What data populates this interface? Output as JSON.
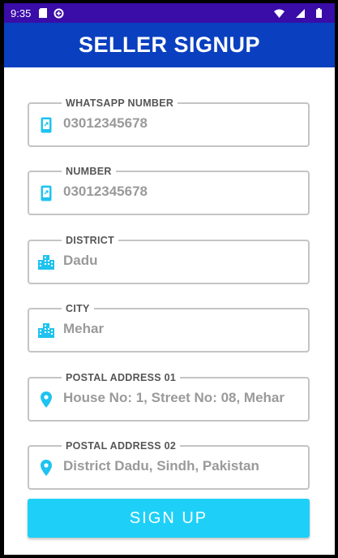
{
  "status_bar": {
    "time": "9:35",
    "icons_left": [
      "sd-card-icon",
      "data-saver-icon"
    ],
    "icons_right": [
      "wifi-icon",
      "signal-icon",
      "battery-icon"
    ]
  },
  "app_bar": {
    "title": "SELLER SIGNUP"
  },
  "form": {
    "fields": [
      {
        "label": "WHATSAPP NUMBER",
        "value": "03012345678",
        "icon": "phone-icon"
      },
      {
        "label": "NUMBER",
        "value": "03012345678",
        "icon": "phone-icon"
      },
      {
        "label": "DISTRICT",
        "value": "Dadu",
        "icon": "building-icon"
      },
      {
        "label": "CITY",
        "value": "Mehar",
        "icon": "building-icon"
      },
      {
        "label": "POSTAL ADDRESS 01",
        "value": "House No: 1, Street No: 08, Mehar",
        "icon": "location-pin-icon"
      },
      {
        "label": "POSTAL ADDRESS 02",
        "value": "District Dadu, Sindh, Pakistan",
        "icon": "location-pin-icon"
      }
    ],
    "submit_label": "SIGN UP"
  },
  "colors": {
    "status_bar": "#3a0ca8",
    "app_bar": "#0a3fbf",
    "accent_icon": "#1ec3f0",
    "button": "#1ed0f7"
  }
}
